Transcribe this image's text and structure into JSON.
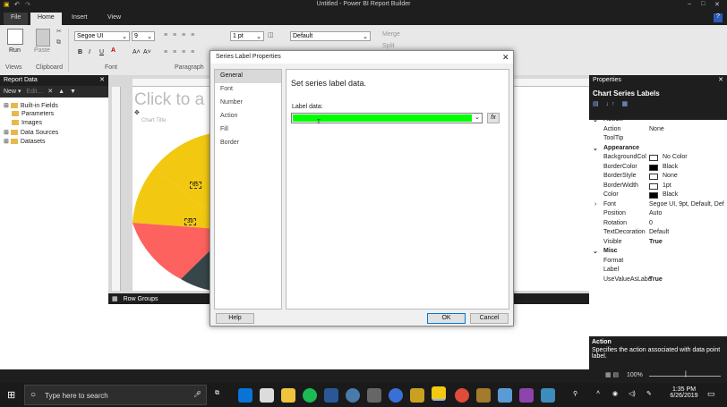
{
  "window": {
    "title": "Untitled - Power BI Report Builder",
    "controls": [
      "–",
      "□",
      "✕"
    ]
  },
  "ribbon": {
    "tabs": [
      "File",
      "Home",
      "Insert",
      "View"
    ],
    "active_tab": "Home",
    "run": "Run",
    "paste": "Paste",
    "groups": [
      "Views",
      "Clipboard",
      "Font",
      "Paragraph"
    ],
    "font_name": "Segoe UI",
    "font_size": "9",
    "line_width": "1 pt",
    "style": "Default",
    "merge": "Merge",
    "split": "Split"
  },
  "report_data": {
    "title": "Report Data",
    "new_label": "New",
    "edit_label": "Edit...",
    "items": [
      "Built-in Fields",
      "Parameters",
      "Images",
      "Data Sources",
      "Datasets"
    ]
  },
  "design": {
    "title_placeholder": "Click to a",
    "chart_title": "Chart Title",
    "label_65": "65",
    "label_39": "39",
    "row_groups": "Row Groups"
  },
  "dialog": {
    "title": "Series Label Properties",
    "nav": [
      "General",
      "Font",
      "Number",
      "Action",
      "Fill",
      "Border"
    ],
    "active_nav": "General",
    "heading": "Set series label data.",
    "label_data": "Label data:",
    "fx": "fx",
    "help": "Help",
    "ok": "OK",
    "cancel": "Cancel"
  },
  "properties": {
    "title": "Properties",
    "subtitle": "Chart Series Labels",
    "sections": [
      {
        "name": "Action",
        "rows": [
          {
            "k": "Action",
            "v": "None"
          },
          {
            "k": "ToolTip",
            "v": ""
          }
        ]
      },
      {
        "name": "Appearance",
        "rows": [
          {
            "k": "BackgroundCol",
            "v": "No Color"
          },
          {
            "k": "BorderColor",
            "v": "Black"
          },
          {
            "k": "BorderStyle",
            "v": "None"
          },
          {
            "k": "BorderWidth",
            "v": "1pt"
          },
          {
            "k": "Color",
            "v": "Black"
          },
          {
            "k": "Font",
            "v": "Segoe UI, 9pt, Default, Def"
          },
          {
            "k": "Position",
            "v": "Auto"
          },
          {
            "k": "Rotation",
            "v": "0"
          },
          {
            "k": "TextDecoration",
            "v": "Default"
          },
          {
            "k": "Visible",
            "v": "True"
          }
        ]
      },
      {
        "name": "Misc",
        "rows": [
          {
            "k": "Format",
            "v": ""
          },
          {
            "k": "Label",
            "v": ""
          },
          {
            "k": "UseValueAsLabe",
            "v": "True"
          }
        ]
      }
    ],
    "help_title": "Action",
    "help_text": "Specifies the action associated with data point label."
  },
  "status": {
    "zoom": "100%"
  },
  "taskbar": {
    "search": "Type here to search",
    "time": "1:35 PM",
    "date": "6/26/2019"
  },
  "colors": {
    "accent": "#f2c811",
    "highlight": "#00ff00",
    "pie_yellow": "#f2c811",
    "pie_red": "#fd625e",
    "pie_dark": "#374649"
  }
}
